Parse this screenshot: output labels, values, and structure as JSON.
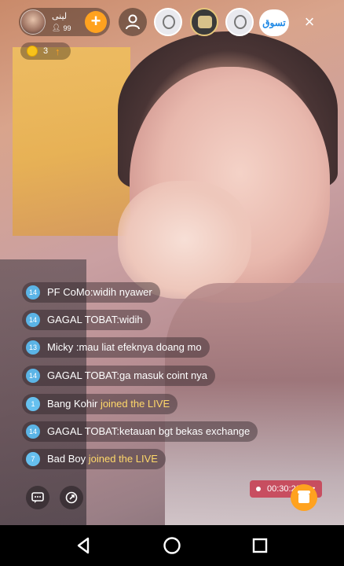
{
  "host": {
    "name": "لينى",
    "count": "99",
    "follow_label": "+"
  },
  "top_icons": [
    "user-icon",
    "badge-face-icon",
    "badge-frame-icon",
    "badge-face-icon"
  ],
  "shop_label": "تسوق",
  "close_label": "×",
  "coins": {
    "count": "3",
    "arrow": "↑"
  },
  "chat": [
    {
      "level": "14",
      "sender": "PF CoMo",
      "separator": ":",
      "text": "widih nyawer",
      "type": "comment"
    },
    {
      "level": "14",
      "sender": "GAGAL TOBAT",
      "separator": ":",
      "text": "widih",
      "type": "comment"
    },
    {
      "level": "13",
      "sender": "Micky ",
      "separator": ":",
      "text": "mau liat efeknya doang mo",
      "type": "comment"
    },
    {
      "level": "14",
      "sender": "GAGAL TOBAT",
      "separator": ":",
      "text": "ga masuk coint nya",
      "type": "comment"
    },
    {
      "level": "1",
      "sender": "Bang Kohir ",
      "separator": "",
      "text": "joined the LIVE",
      "type": "join"
    },
    {
      "level": "14",
      "sender": "GAGAL TOBAT",
      "separator": ":",
      "text": "ketauan bgt bekas exchange",
      "type": "comment"
    },
    {
      "level": "7",
      "sender": "Bad Boy ",
      "separator": "",
      "text": "joined the LIVE",
      "type": "join"
    }
  ],
  "timer": "00:30:29",
  "colors": {
    "accent": "#ffa21f",
    "level_badge": "#5bb4e6",
    "join_text": "#ffd86a",
    "timer_bg": "#c83c50"
  }
}
